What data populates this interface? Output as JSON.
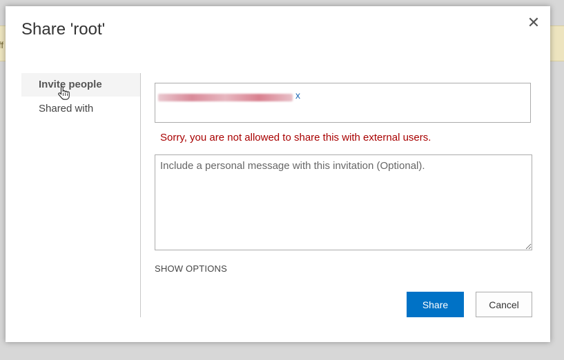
{
  "background": {
    "banner_text": "ff"
  },
  "dialog": {
    "title": "Share 'root'",
    "close_glyph": "✕"
  },
  "nav": {
    "items": [
      {
        "label": "Invite people",
        "active": true
      },
      {
        "label": "Shared with",
        "active": false
      }
    ]
  },
  "invite": {
    "recipient_remove": "x",
    "error_message": "Sorry, you are not allowed to share this with external users.",
    "message_placeholder": "Include a personal message with this invitation (Optional).",
    "message_value": "",
    "show_options_label": "SHOW OPTIONS"
  },
  "buttons": {
    "share_label": "Share",
    "cancel_label": "Cancel"
  },
  "colors": {
    "accent": "#0072c6",
    "error": "#a80000",
    "banner": "#ede4bf"
  }
}
